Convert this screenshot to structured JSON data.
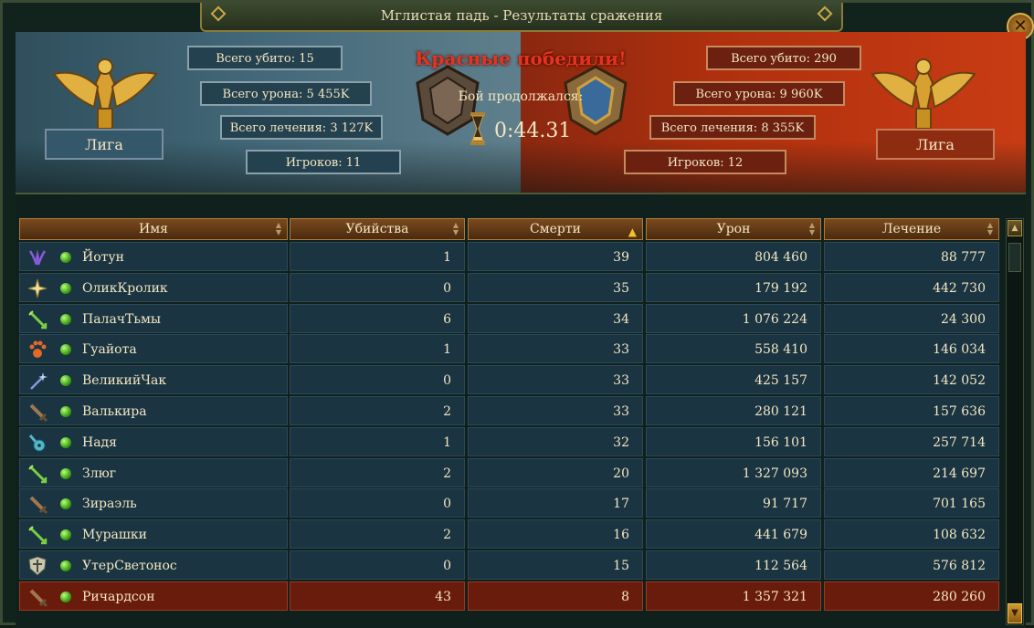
{
  "window": {
    "title": "Мглистая падь - Результаты сражения",
    "close_label": "✕"
  },
  "battle": {
    "winner_text": "Красные победили!",
    "duration_label": "Бой продолжался:",
    "duration": "0:44.31"
  },
  "blue_team": {
    "name": "Лига",
    "kills": "Всего убито: 15",
    "damage": "Всего урона: 5 455K",
    "healing": "Всего лечения: 3 127K",
    "players": "Игроков: 11"
  },
  "red_team": {
    "name": "Лига",
    "kills": "Всего убито: 290",
    "damage": "Всего урона: 9 960K",
    "healing": "Всего лечения: 8 355K",
    "players": "Игроков: 12"
  },
  "columns": {
    "name": "Имя",
    "kills": "Убийства",
    "deaths": "Смерти",
    "damage": "Урон",
    "healing": "Лечение"
  },
  "rows": [
    {
      "icon": "claw-icon",
      "name": "Йотун",
      "kills": "1",
      "deaths": "39",
      "damage": "804 460",
      "healing": "88 777",
      "highlight": false
    },
    {
      "icon": "cross-icon",
      "name": "ОликКролик",
      "kills": "0",
      "deaths": "35",
      "damage": "179 192",
      "healing": "442 730",
      "highlight": false
    },
    {
      "icon": "arrow-icon",
      "name": "ПалачТьмы",
      "kills": "6",
      "deaths": "34",
      "damage": "1 076 224",
      "healing": "24 300",
      "highlight": false
    },
    {
      "icon": "paw-icon",
      "name": "Гуайота",
      "kills": "1",
      "deaths": "33",
      "damage": "558 410",
      "healing": "146 034",
      "highlight": false
    },
    {
      "icon": "wand-icon",
      "name": "ВеликийЧак",
      "kills": "0",
      "deaths": "33",
      "damage": "425 157",
      "healing": "142 052",
      "highlight": false
    },
    {
      "icon": "sword-icon",
      "name": "Валькира",
      "kills": "2",
      "deaths": "33",
      "damage": "280 121",
      "healing": "157 636",
      "highlight": false
    },
    {
      "icon": "lute-icon",
      "name": "Надя",
      "kills": "1",
      "deaths": "32",
      "damage": "156 101",
      "healing": "257 714",
      "highlight": false
    },
    {
      "icon": "arrow-icon",
      "name": "Злюг",
      "kills": "2",
      "deaths": "20",
      "damage": "1 327 093",
      "healing": "214 697",
      "highlight": false
    },
    {
      "icon": "sword-icon",
      "name": "Зираэль",
      "kills": "0",
      "deaths": "17",
      "damage": "91 717",
      "healing": "701 165",
      "highlight": false
    },
    {
      "icon": "arrow-icon",
      "name": "Мурашки",
      "kills": "2",
      "deaths": "16",
      "damage": "441 679",
      "healing": "108 632",
      "highlight": false
    },
    {
      "icon": "shield-icon",
      "name": "УтерСветонос",
      "kills": "0",
      "deaths": "15",
      "damage": "112 564",
      "healing": "576 812",
      "highlight": false
    },
    {
      "icon": "sword-icon",
      "name": "Ричардсон",
      "kills": "43",
      "deaths": "8",
      "damage": "1 357 321",
      "healing": "280 260",
      "highlight": true
    }
  ]
}
